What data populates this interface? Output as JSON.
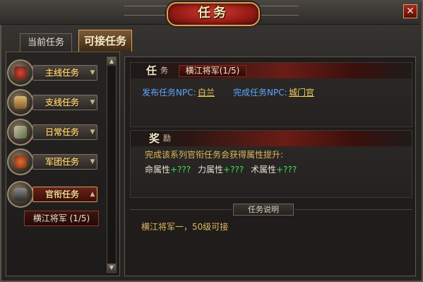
{
  "window": {
    "title": "任务",
    "close_symbol": "✕"
  },
  "tabs": [
    {
      "label": "当前任务",
      "active": false
    },
    {
      "label": "可接任务",
      "active": true
    }
  ],
  "categories": [
    {
      "label": "主线任务",
      "icon": "main-quest-icon",
      "active": false
    },
    {
      "label": "支线任务",
      "icon": "scroll-icon",
      "active": false
    },
    {
      "label": "日常任务",
      "icon": "daily-quest-icon",
      "active": false
    },
    {
      "label": "军团任务",
      "icon": "legion-icon",
      "active": false
    },
    {
      "label": "官衔任务",
      "icon": "rank-icon",
      "active": true
    }
  ],
  "selected_task": "横江将军 (1/5)",
  "task": {
    "heading_big": "任",
    "heading_small": "务",
    "name_tag": "横江将军(1/5)",
    "issuer_label": "发布任务NPC:",
    "issuer_npc": "白兰",
    "finisher_label": "完成任务NPC:",
    "finisher_npc": "城门官"
  },
  "reward": {
    "heading_big": "奖",
    "heading_small": "励",
    "line1": "完成该系列官衔任务会获得属性提升:",
    "attrs": [
      {
        "name": "命属性",
        "value": "+???"
      },
      {
        "name": "力属性",
        "value": "+???"
      },
      {
        "name": "术属性",
        "value": "+???"
      }
    ]
  },
  "description": {
    "label": "任务说明",
    "text": "横江将军一，50级可接"
  },
  "scroll": {
    "up": "▲",
    "down": "▼"
  },
  "colors": {
    "accent_red": "#9a1d17",
    "gold_text": "#e0b85c",
    "npc_link": "#f0d060",
    "label_blue": "#5fa6ff",
    "attr_green": "#3ee05a"
  }
}
